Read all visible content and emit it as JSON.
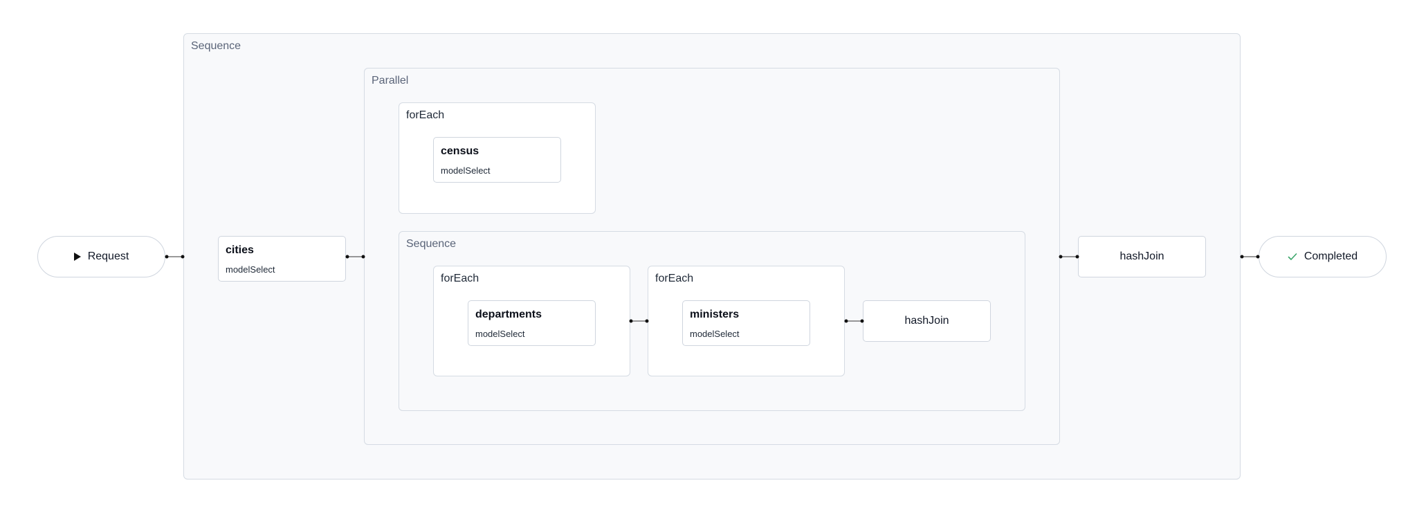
{
  "start": {
    "label": "Request",
    "icon": "play-icon"
  },
  "end": {
    "label": "Completed",
    "icon": "check-icon",
    "icon_color": "#3aa56a"
  },
  "outer_sequence": {
    "label": "Sequence"
  },
  "cities": {
    "title": "cities",
    "subtitle": "modelSelect"
  },
  "parallel": {
    "label": "Parallel"
  },
  "foreach_census": {
    "label": "forEach",
    "node": {
      "title": "census",
      "subtitle": "modelSelect"
    }
  },
  "inner_sequence": {
    "label": "Sequence"
  },
  "foreach_departments": {
    "label": "forEach",
    "node": {
      "title": "departments",
      "subtitle": "modelSelect"
    }
  },
  "foreach_ministers": {
    "label": "forEach",
    "node": {
      "title": "ministers",
      "subtitle": "modelSelect"
    }
  },
  "inner_hashjoin": {
    "label": "hashJoin"
  },
  "outer_hashjoin": {
    "label": "hashJoin"
  }
}
